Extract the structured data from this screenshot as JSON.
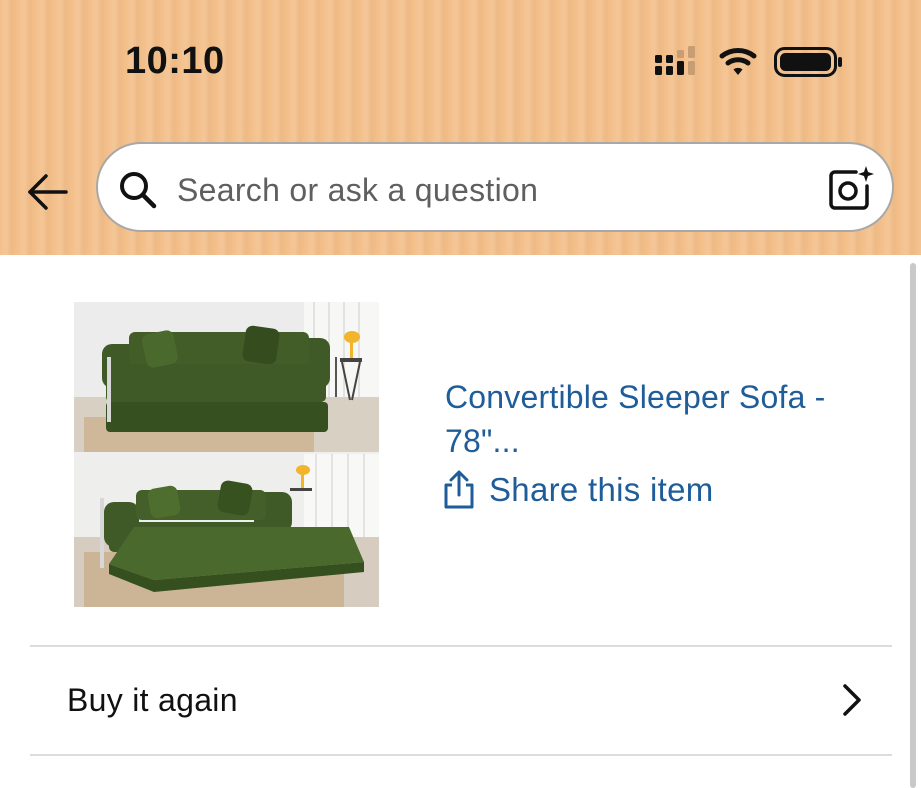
{
  "status_bar": {
    "time": "10:10",
    "icons": [
      "cellular-signal-icon",
      "wifi-icon",
      "battery-icon"
    ]
  },
  "header": {
    "back_icon": "arrow-left-icon",
    "search": {
      "placeholder": "Search or ask a question",
      "left_icon": "search-icon",
      "right_icon": "camera-sparkle-icon"
    }
  },
  "item": {
    "title": "Convertible Sleeper Sofa - 78\"...",
    "share_label": "Share this item",
    "share_icon": "share-upload-icon",
    "image_description_icon": "product-image"
  },
  "actions": {
    "buy_again_label": "Buy it again",
    "buy_again_icon": "chevron-right-icon"
  },
  "colors": {
    "header_bg": "#f3c08c",
    "link": "#1e5d99",
    "text": "#111111",
    "sofa_green": "#3f5a26"
  }
}
